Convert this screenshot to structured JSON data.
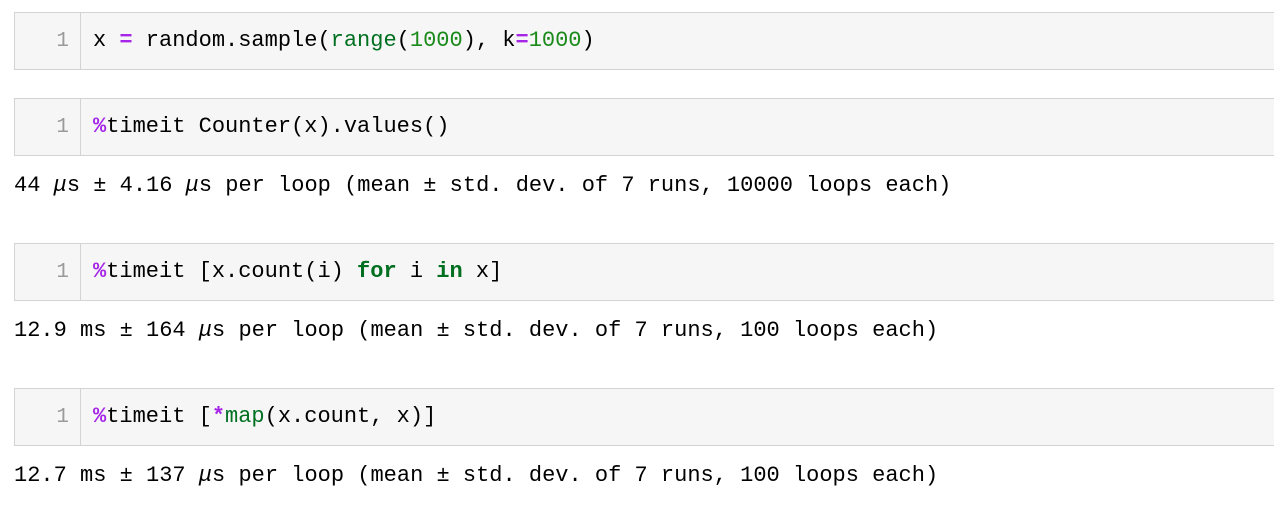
{
  "notebook": {
    "cells": [
      {
        "name": "cell-sample",
        "prompt": "1",
        "tokens": [
          {
            "text": "x ",
            "type": "plain"
          },
          {
            "text": "=",
            "type": "op"
          },
          {
            "text": " random.sample(",
            "type": "plain"
          },
          {
            "text": "range",
            "type": "builtin"
          },
          {
            "text": "(",
            "type": "plain"
          },
          {
            "text": "1000",
            "type": "num"
          },
          {
            "text": "), k",
            "type": "plain"
          },
          {
            "text": "=",
            "type": "op"
          },
          {
            "text": "1000",
            "type": "num"
          },
          {
            "text": ")",
            "type": "plain"
          }
        ],
        "plain": "x = random.sample(range(1000), k=1000)"
      },
      {
        "name": "cell-timeit-counter",
        "prompt": "1",
        "tokens": [
          {
            "text": "%",
            "type": "magic"
          },
          {
            "text": "timeit Counter(x).values()",
            "type": "plain"
          }
        ],
        "plain": "%timeit Counter(x).values()"
      },
      {
        "name": "cell-timeit-listcomp",
        "prompt": "1",
        "tokens": [
          {
            "text": "%",
            "type": "magic"
          },
          {
            "text": "timeit [x.count(i) ",
            "type": "plain"
          },
          {
            "text": "for",
            "type": "kw"
          },
          {
            "text": " i ",
            "type": "plain"
          },
          {
            "text": "in",
            "type": "kw"
          },
          {
            "text": " x]",
            "type": "plain"
          }
        ],
        "plain": "%timeit [x.count(i) for i in x]"
      },
      {
        "name": "cell-timeit-map",
        "prompt": "1",
        "tokens": [
          {
            "text": "%",
            "type": "magic"
          },
          {
            "text": "timeit [",
            "type": "plain"
          },
          {
            "text": "*",
            "type": "op"
          },
          {
            "text": "map",
            "type": "builtin"
          },
          {
            "text": "(x.count, x)]",
            "type": "plain"
          }
        ],
        "plain": "%timeit [*map(x.count, x)]"
      }
    ],
    "outputs": [
      {
        "name": "output-counter",
        "segments": [
          {
            "text": "44 ",
            "style": "plain"
          },
          {
            "text": "μ",
            "style": "mu"
          },
          {
            "text": "s ± 4.16 ",
            "style": "plain"
          },
          {
            "text": "μ",
            "style": "mu"
          },
          {
            "text": "s per loop (mean ± std. dev. of 7 runs, 10000 loops each)",
            "style": "plain"
          }
        ],
        "plain": "44 μs ± 4.16 μs per loop (mean ± std. dev. of 7 runs, 10000 loops each)"
      },
      {
        "name": "output-listcomp",
        "segments": [
          {
            "text": "12.9 ms ± 164 ",
            "style": "plain"
          },
          {
            "text": "μ",
            "style": "mu"
          },
          {
            "text": "s per loop (mean ± std. dev. of 7 runs, 100 loops each)",
            "style": "plain"
          }
        ],
        "plain": "12.9 ms ± 164 μs per loop (mean ± std. dev. of 7 runs, 100 loops each)"
      },
      {
        "name": "output-map",
        "segments": [
          {
            "text": "12.7 ms ± 137 ",
            "style": "plain"
          },
          {
            "text": "μ",
            "style": "mu"
          },
          {
            "text": "s per loop (mean ± std. dev. of 7 runs, 100 loops each)",
            "style": "plain"
          }
        ],
        "plain": "12.7 ms ± 137 μs per loop (mean ± std. dev. of 7 runs, 100 loops each)"
      }
    ]
  },
  "colors": {
    "cell_background": "#f6f6f6",
    "cell_border": "#d3d3d3",
    "page_background": "#ffffff",
    "text": "#000000",
    "line_number": "#9a9a9a",
    "operator": "#a626e8",
    "keyword": "#007020",
    "builtin": "#007020",
    "number": "#1a8a1a"
  }
}
